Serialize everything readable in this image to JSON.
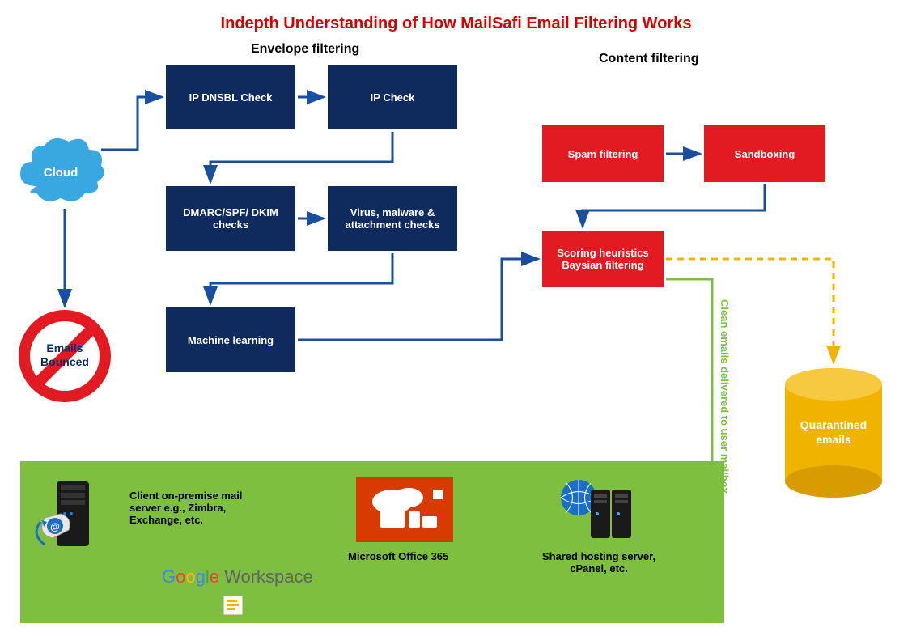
{
  "title": "Indepth Understanding of How MailSafi Email Filtering Works",
  "sections": {
    "envelope": "Envelope filtering",
    "content": "Content filtering"
  },
  "envelope_nodes": {
    "ip_dnsbl": "IP DNSBL Check",
    "ip_check": "IP Check",
    "dmarc": "DMARC/SPF/ DKIM checks",
    "virus": "Virus, malware & attachment checks",
    "ml": "Machine learning"
  },
  "content_nodes": {
    "spam": "Spam filtering",
    "sandbox": "Sandboxing",
    "scoring_line1": "Scoring heuristics",
    "scoring_line2": "Baysian filtering"
  },
  "cloud_label": "Cloud",
  "bounced_line1": "Emails",
  "bounced_line2": "Bounced",
  "delivery_label": "Clean emails delivered to user mailbox",
  "quarantine_label": "Quarantined emails",
  "panel": {
    "onprem": "Client on-premise mail server e.g., Zimbra, Exchange, etc.",
    "office365": "Microsoft Office 365",
    "shared": "Shared hosting server, cPanel, etc.",
    "google": "Google Workspace",
    "google_g": "G",
    "google_o1": "o",
    "google_o2": "o",
    "google_g2": "g",
    "google_l": "l",
    "google_e": "e",
    "workspace": " Workspace"
  },
  "colors": {
    "navy": "#0f2b5e",
    "red": "#e21b22",
    "title_red": "#d40000",
    "green": "#7fbf3f",
    "blue_arrow": "#1a4fa0",
    "cloud_blue": "#39a7e0",
    "yellow": "#f0b400",
    "orange": "#d83b01"
  }
}
